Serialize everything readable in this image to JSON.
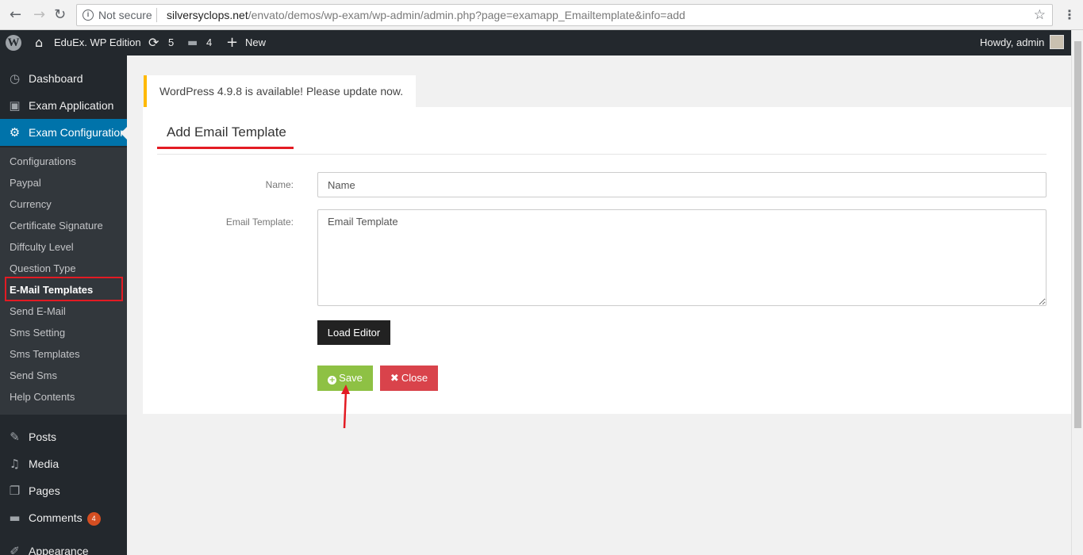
{
  "browser": {
    "back": "←",
    "forward": "→",
    "reload": "↻",
    "security": "Not secure",
    "url_domain": "silversyclops.net",
    "url_path": "/envato/demos/wp-exam/wp-admin/admin.php?page=examapp_Emailtemplate&info=add",
    "menu": "⋮",
    "star": "☆"
  },
  "adminbar": {
    "site_name": "EduEx. WP Edition",
    "updates_count": "5",
    "comments_count": "4",
    "new_label": "New",
    "howdy": "Howdy, admin"
  },
  "sidebar": {
    "top_items": [
      {
        "label": "Dashboard",
        "icon": "dashboard-icon"
      },
      {
        "label": "Exam Application",
        "icon": "id-card-icon"
      },
      {
        "label": "Exam Configuration",
        "icon": "gear-icon"
      }
    ],
    "submenu": [
      "Configurations",
      "Paypal",
      "Currency",
      "Certificate Signature",
      "Diffculty Level",
      "Question Type",
      "E-Mail Templates",
      "Send E-Mail",
      "Sms Setting",
      "Sms Templates",
      "Send Sms",
      "Help Contents"
    ],
    "bottom_items": [
      {
        "label": "Posts",
        "icon": "pin-icon"
      },
      {
        "label": "Media",
        "icon": "media-icon"
      },
      {
        "label": "Pages",
        "icon": "pages-icon"
      },
      {
        "label": "Comments",
        "icon": "comment-icon",
        "badge": "4"
      },
      {
        "label": "Appearance",
        "icon": "brush-icon"
      }
    ]
  },
  "notice": {
    "text": "WordPress 4.9.8 is available! Please update now."
  },
  "form": {
    "title": "Add Email Template",
    "name_label": "Name:",
    "name_placeholder": "Name",
    "template_label": "Email Template:",
    "template_placeholder": "Email Template",
    "load_editor": "Load Editor",
    "save": "Save",
    "close": "Close"
  },
  "colors": {
    "adminbar": "#23282d",
    "active_menu": "#0073aa",
    "highlight": "#e31b23",
    "save": "#8ec144",
    "close": "#d9434b",
    "notice_border": "#ffb900"
  }
}
